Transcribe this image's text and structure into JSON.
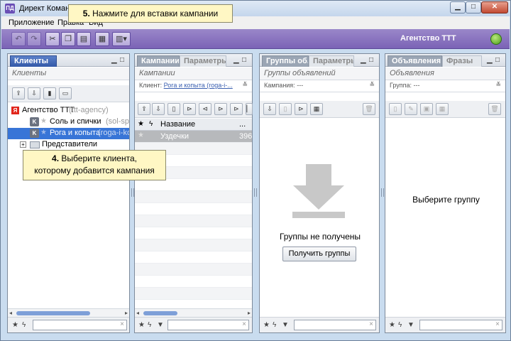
{
  "window": {
    "title": "Директ Командер",
    "min_glyph": "▁",
    "max_glyph": "□",
    "close_glyph": "✕"
  },
  "menu": [
    "Приложение",
    "Правка",
    "Вид"
  ],
  "toolbar": {
    "agency_name": "Агентство ТТТ"
  },
  "tips": {
    "step5_number": "5.",
    "step5_text": "Нажмите для вставки кампании",
    "step4_number": "4.",
    "step4_line1": "Выберите клиента,",
    "step4_line2": "которому добавится кампания"
  },
  "clients_pane": {
    "tab": "Клиенты",
    "subtitle": "Клиенты",
    "tree": {
      "agency_label": "Агентство ТТТ",
      "agency_login": "(ttt-agency)",
      "clients": [
        {
          "name": "Соль и спички",
          "login": "(sol-spichki)"
        },
        {
          "name": "Рога и копыта",
          "login": "(roga-i-kopyta)"
        }
      ],
      "folder_label": "Представители"
    }
  },
  "campaigns_pane": {
    "tab_active": "Кампании",
    "tab_other": "Параметры",
    "subtitle": "Кампании",
    "filter_label": "Клиент:",
    "filter_value": "Рога и копыта (roga-i-...",
    "columns": [
      "Название",
      "..."
    ],
    "rows": [
      {
        "name": "Уздечки",
        "extra": "396"
      }
    ]
  },
  "groups_pane": {
    "tab_active": "Группы об...",
    "tab_other": "Параметры",
    "subtitle": "Группы объявлений",
    "filter_label": "Кампания:",
    "filter_value": "---",
    "empty_text": "Группы не получены",
    "get_button": "Получить группы"
  },
  "ads_pane": {
    "tab_active": "Объявления",
    "tab_other": "Фразы",
    "subtitle": "Объявления",
    "filter_label": "Группа:",
    "filter_value": "---",
    "empty_text": "Выберите группу"
  },
  "colors": {
    "toolbar_purple": "#7b63b6",
    "selection_blue": "#3875d7",
    "tip_yellow": "#fff7c4"
  }
}
